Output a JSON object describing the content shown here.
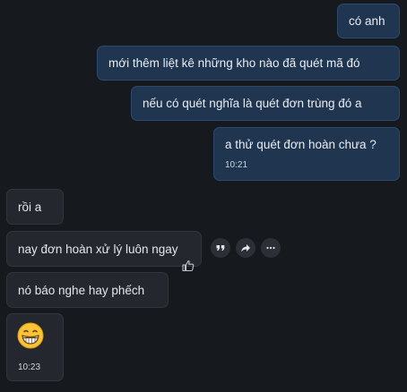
{
  "messages": {
    "sent": [
      {
        "text": "có anh"
      },
      {
        "text": "mới thêm liệt kê những kho nào đã quét mã đó"
      },
      {
        "text": "nếu có quét nghĩa là quét đơn trùng đó a"
      },
      {
        "text": "a thử quét đơn hoàn chưa ?",
        "time": "10:21"
      }
    ],
    "received": [
      {
        "text": "rồi a"
      },
      {
        "text": "nay đơn hoàn xử lý luôn ngay"
      },
      {
        "text": "nó báo nghe hay phếch"
      },
      {
        "emoji": "😁",
        "time": "10:23"
      }
    ]
  },
  "hover_actions": {
    "icons": [
      "quote-icon",
      "forward-icon",
      "more-icon"
    ]
  },
  "reaction": {
    "icon": "thumbs-up-icon"
  }
}
